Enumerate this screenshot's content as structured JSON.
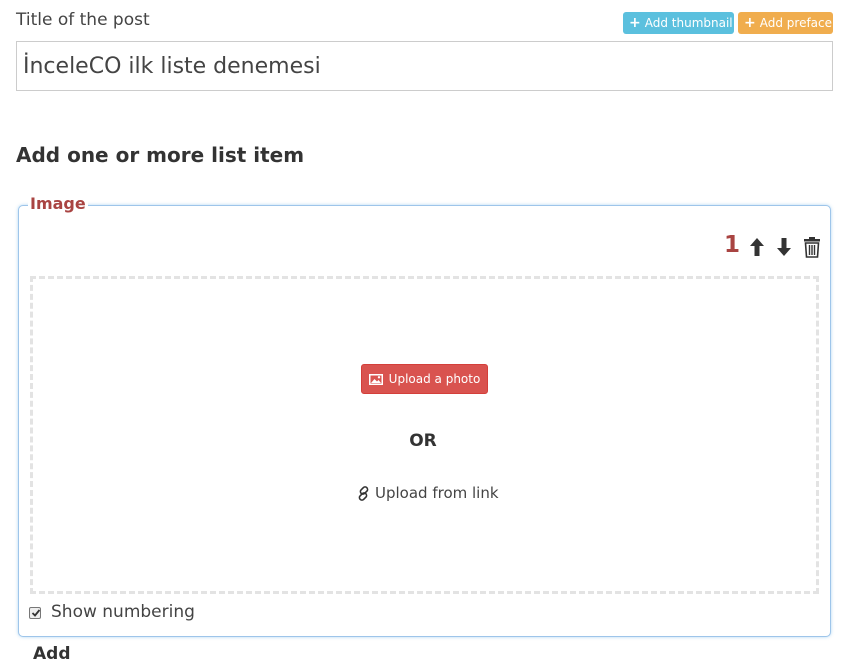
{
  "form": {
    "title_label": "Title of the post",
    "title_value": "İnceleCO ilk liste denemesi",
    "add_thumbnail": "Add thumbnail",
    "add_preface": "Add preface"
  },
  "section": {
    "heading": "Add one or more list item"
  },
  "item": {
    "type_label": "Image",
    "number": "1",
    "upload_photo": "Upload a photo",
    "or_text": "OR",
    "upload_from_link": "Upload from link",
    "show_numbering": "Show numbering",
    "show_numbering_checked": true
  },
  "colors": {
    "thumbnail_btn": "#5bc0de",
    "preface_btn": "#f0ad4e",
    "upload_btn": "#d9534f",
    "accent_red": "#a94442",
    "panel_border": "#9ec5ea"
  },
  "icons": {
    "thumbnail": "plus-icon",
    "preface": "plus-icon",
    "move_up": "arrow-up-icon",
    "move_down": "arrow-down-icon",
    "delete": "trash-icon",
    "upload_photo": "picture-icon",
    "upload_link": "link-icon",
    "checkbox": "check-icon"
  }
}
